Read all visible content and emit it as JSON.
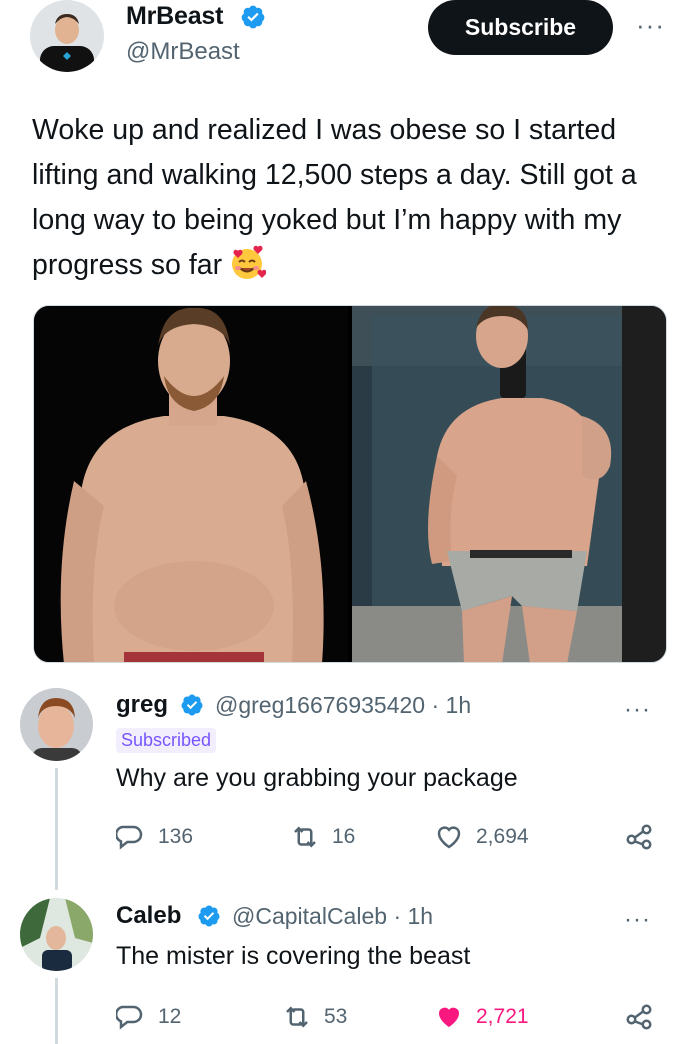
{
  "tweet": {
    "author_name": "MrBeast",
    "author_handle": "@MrBeast",
    "subscribe_label": "Subscribe",
    "more_label": "···",
    "text": "Woke up and realized I was obese so I started lifting and walking 12,500 steps a day. Still got a long way to being yoked but I’m happy with my progress so far",
    "emoji": "smiling-face-with-hearts"
  },
  "replies": [
    {
      "name": "greg",
      "handle": "@greg16676935420",
      "time": "· 1h",
      "badge": "Subscribed",
      "text": "Why are you grabbing your package",
      "replies": "136",
      "retweets": "16",
      "likes": "2,694",
      "liked": false
    },
    {
      "name": "Caleb",
      "handle": "@CapitalCaleb",
      "time": "· 1h",
      "text": "The mister is covering the beast",
      "replies": "12",
      "retweets": "53",
      "likes": "2,721",
      "liked": true
    }
  ],
  "colors": {
    "verified": "#1d9bf0",
    "like_active": "#f91880",
    "secondary_text": "#536471",
    "subscribed_badge": "#7856ff"
  }
}
